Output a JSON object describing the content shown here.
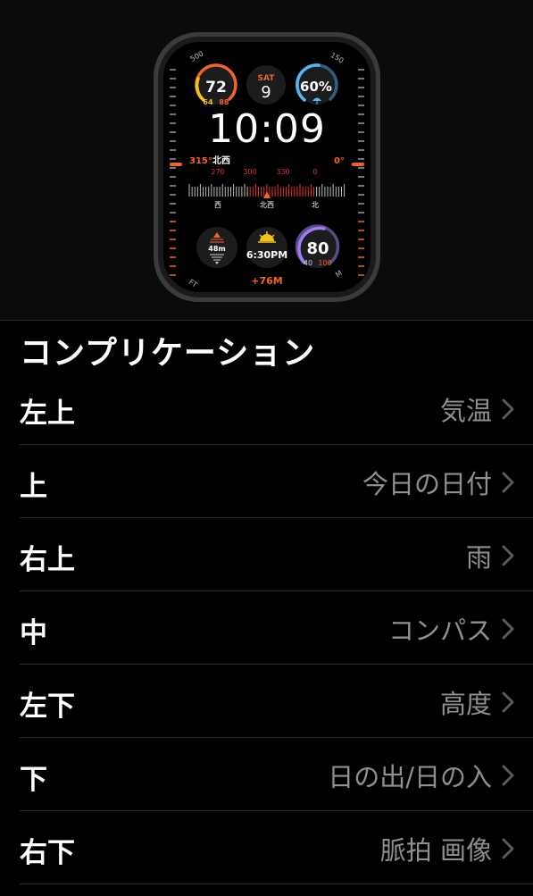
{
  "watch": {
    "bezel_left": "500",
    "bezel_right": "150",
    "bezel_bl": "FT",
    "bezel_br": "M",
    "temp": "72",
    "temp_lo": "64",
    "temp_hi": "88",
    "day": "SAT",
    "date": "9",
    "rain": "60%",
    "time": "10:09",
    "heading": "315°",
    "heading_dir": "北西",
    "zero_label": "0°",
    "scale": [
      "270",
      "300",
      "330",
      "0"
    ],
    "dirs": [
      "西",
      "北西",
      "北"
    ],
    "altitude": "48m",
    "sunset": "6:30PM",
    "hr": "80",
    "hr_lo": "40",
    "hr_hi": "100",
    "elevation": "+76M",
    "colors": {
      "orange": "#f0632a",
      "red": "#e2322b",
      "yellow": "#f3c316",
      "blue": "#56b7f0",
      "purple": "#a07cf0"
    }
  },
  "section_title": "コンプリケーション",
  "rows": [
    {
      "label": "左上",
      "value": "気温"
    },
    {
      "label": "上",
      "value": "今日の日付"
    },
    {
      "label": "右上",
      "value": "雨"
    },
    {
      "label": "中",
      "value": "コンパス"
    },
    {
      "label": "左下",
      "value": "高度"
    },
    {
      "label": "下",
      "value": "日の出/日の入"
    },
    {
      "label": "右下",
      "value": "脈拍 画像"
    }
  ]
}
